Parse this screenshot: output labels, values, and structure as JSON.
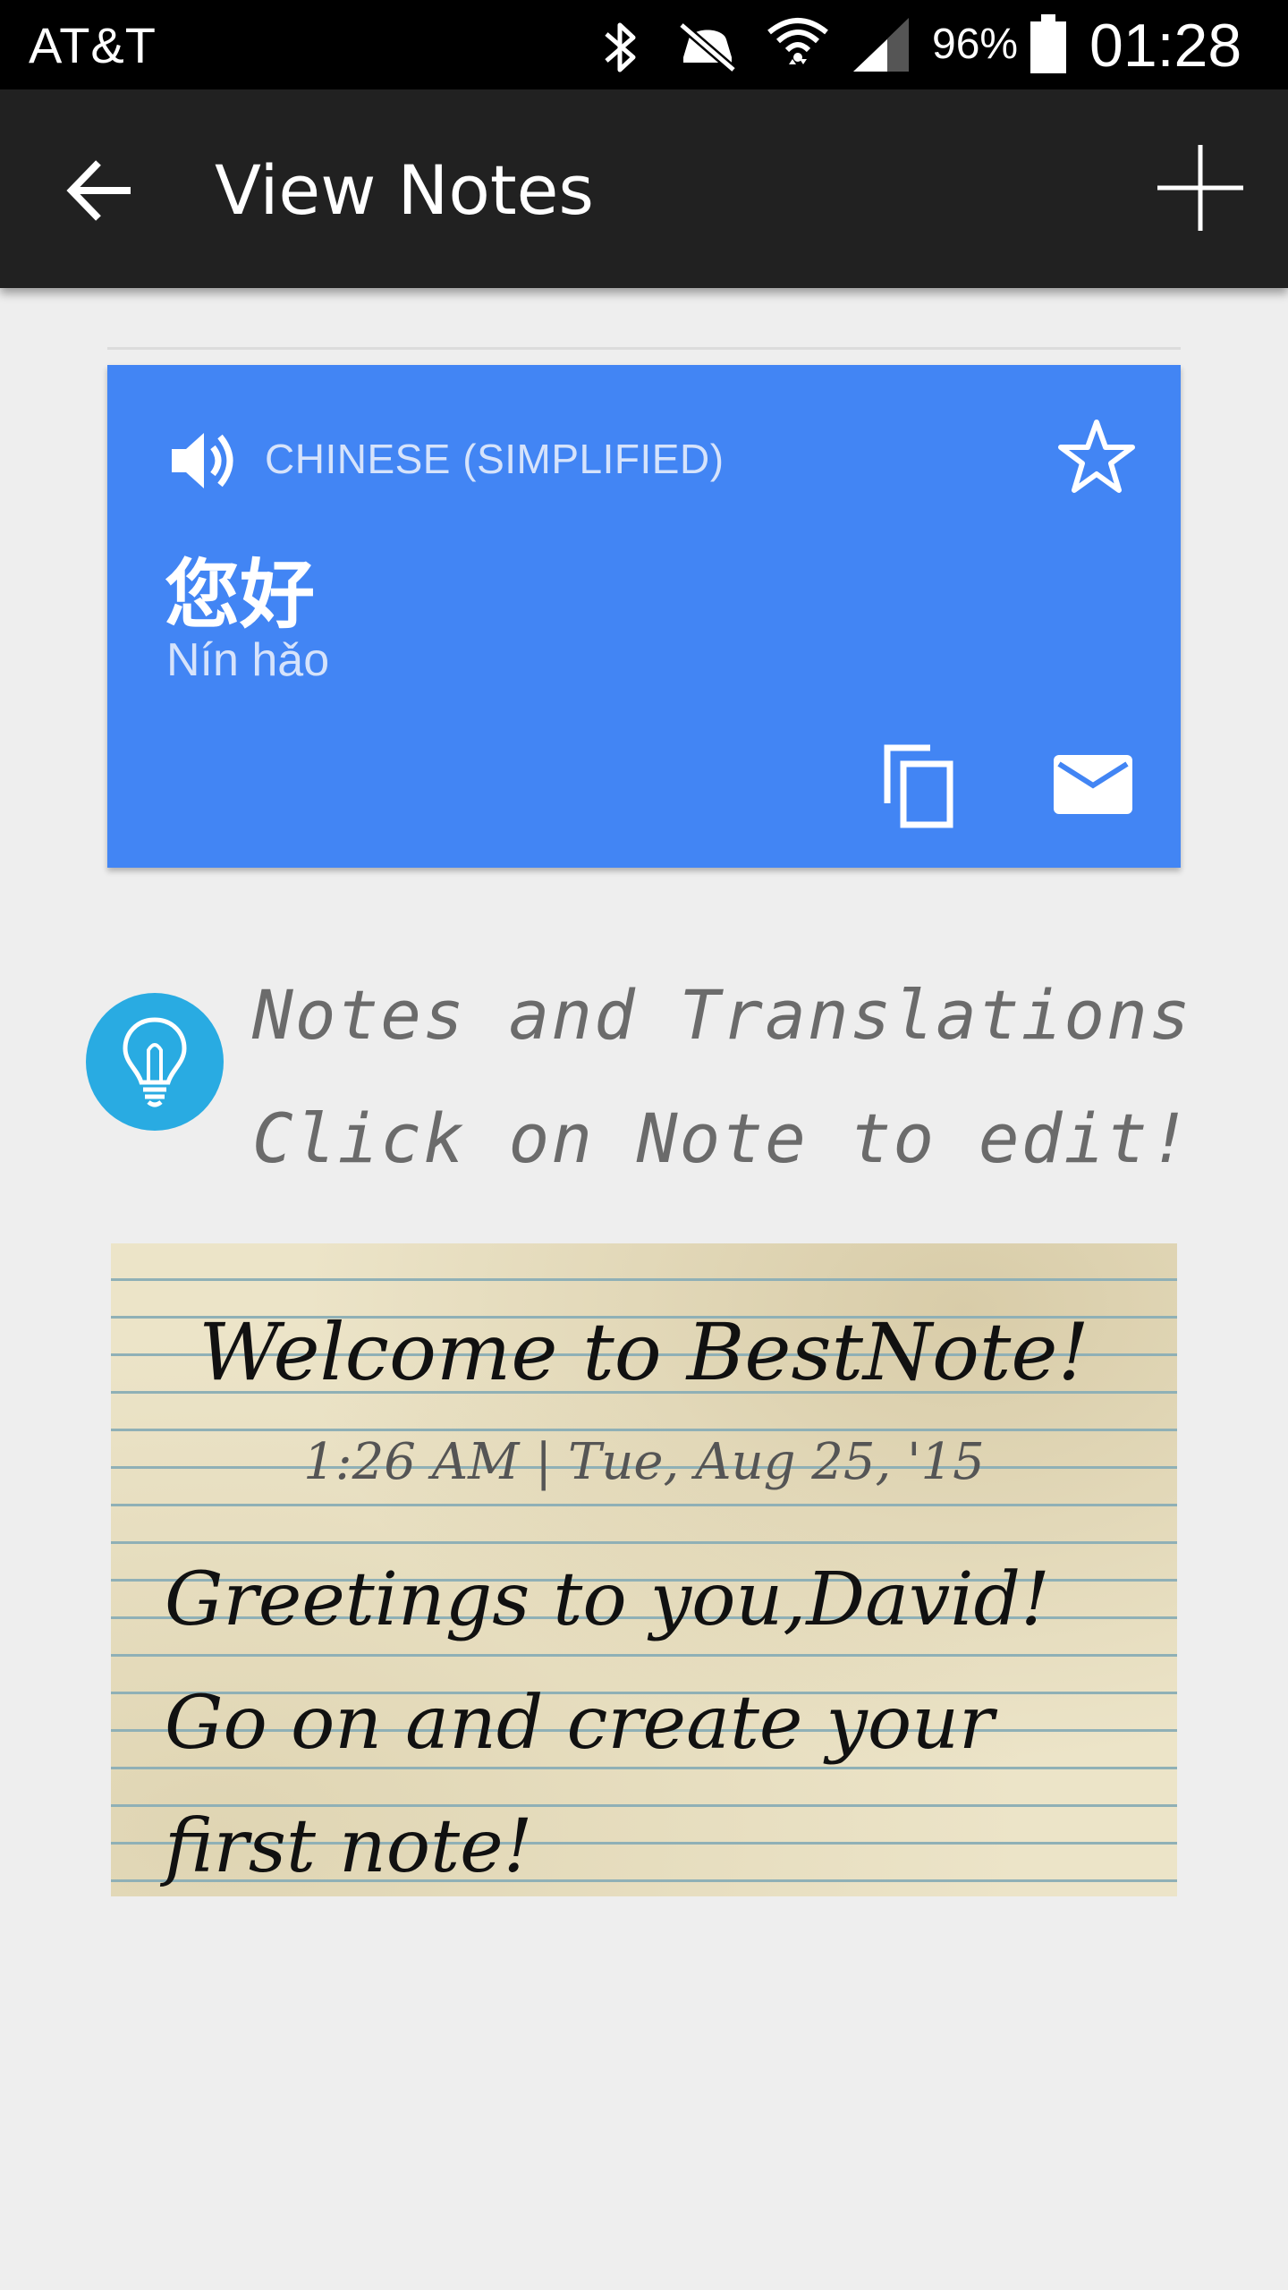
{
  "status_bar": {
    "carrier": "AT&T",
    "battery_percent": "96%",
    "time": "01:28",
    "icons": [
      "bluetooth-icon",
      "mute-icon",
      "wifi-icon",
      "signal-icon",
      "battery-icon"
    ]
  },
  "app_bar": {
    "title": "View Notes",
    "back_icon": "arrow-back-icon",
    "add_icon": "plus-icon"
  },
  "translation_card": {
    "language": "CHINESE (SIMPLIFIED)",
    "translated_text": "您好",
    "romanization": "Nín hǎo",
    "background_color": "#4285f4",
    "icons": [
      "speaker-icon",
      "star-icon",
      "copy-icon",
      "email-icon"
    ]
  },
  "tip": {
    "line1": "Notes and Translations",
    "line2": "Click on Note to edit!",
    "icon": "lightbulb-icon",
    "icon_color": "#29abe2"
  },
  "note": {
    "title": "Welcome to BestNote!",
    "date": "1:26 AM | Tue, Aug 25, '15",
    "body": "Greetings to you,David! Go on and create your first note!"
  }
}
